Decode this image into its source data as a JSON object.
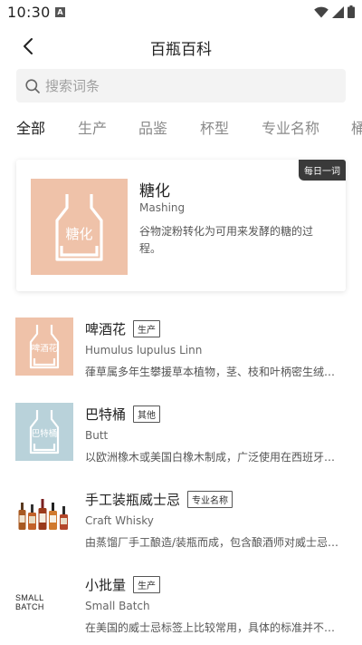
{
  "status_bar": {
    "time": "10:30",
    "notification_letter": "A"
  },
  "header": {
    "title": "百瓶百科"
  },
  "search": {
    "placeholder": "搜索词条"
  },
  "tabs": [
    {
      "label": "全部",
      "active": true
    },
    {
      "label": "生产",
      "active": false
    },
    {
      "label": "品鉴",
      "active": false
    },
    {
      "label": "杯型",
      "active": false
    },
    {
      "label": "专业名称",
      "active": false
    },
    {
      "label": "桶",
      "active": false
    }
  ],
  "featured": {
    "badge": "每日一词",
    "thumb_text": "糖化",
    "thumb_color": "#efc2a9",
    "title": "糖化",
    "subtitle": "Mashing",
    "description": "谷物淀粉转化为可用来发酵的糖的过程。"
  },
  "items": [
    {
      "thumb_text": "啤酒花",
      "thumb_color": "#efc2a9",
      "title": "啤酒花",
      "tag": "生产",
      "subtitle": "Humulus lupulus Linn",
      "description": "葎草属多年生攀援草本植物，茎、枝和叶柄密生绒毛和倒钩刺"
    },
    {
      "thumb_text": "巴特桶",
      "thumb_color": "#b9d2da",
      "title": "巴特桶",
      "tag": "其他",
      "subtitle": "Butt",
      "description": "以欧洲橡木或美国白橡木制成，广泛使用在西班牙雪莉酒的陈酿"
    },
    {
      "thumb_text": "",
      "thumb_color": "#ffffff",
      "title": "手工装瓶威士忌",
      "tag": "专业名称",
      "subtitle": "Craft Whisky",
      "description": "由蒸馏厂手工酿造/装瓶而成，包含酿酒师对威士忌的独特理解"
    },
    {
      "thumb_text": "SMALL BATCH",
      "thumb_color": "#ffffff",
      "title": "小批量",
      "tag": "生产",
      "subtitle": "Small Batch",
      "description": "在美国的威士忌标签上比较常用，具体的标准并不统一"
    }
  ]
}
